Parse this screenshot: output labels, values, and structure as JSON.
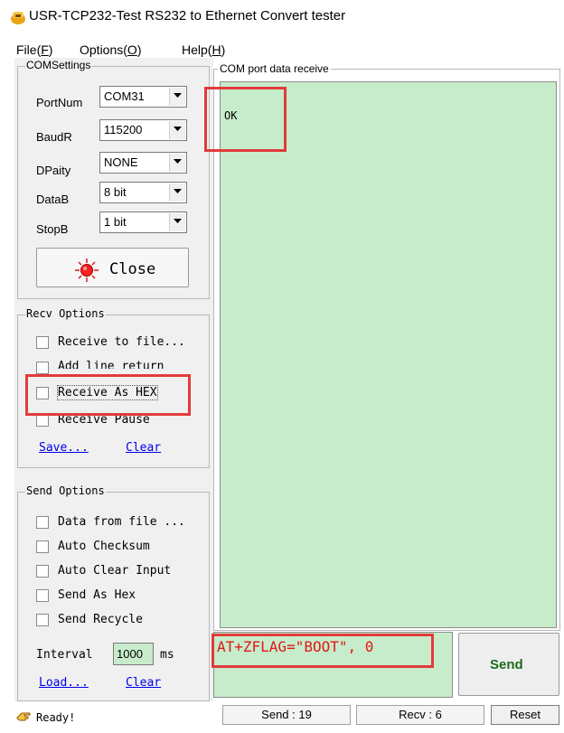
{
  "window": {
    "title": "USR-TCP232-Test  RS232 to Ethernet Convert tester"
  },
  "menu": [
    {
      "label": "File",
      "hotkey": "F"
    },
    {
      "label": "Options",
      "hotkey": "O"
    },
    {
      "label": "Help",
      "hotkey": "H"
    }
  ],
  "com_settings": {
    "title": "COMSettings",
    "port_label": "PortNum",
    "port_value": "COM31",
    "baud_label": "BaudR",
    "baud_value": "115200",
    "parity_label": "DPaity",
    "parity_value": "NONE",
    "databits_label": "DataB",
    "databits_value": "8 bit",
    "stopbits_label": "StopB",
    "stopbits_value": "1 bit",
    "close_button": "Close"
  },
  "recv_options": {
    "title": "Recv Options",
    "items": [
      {
        "label": "Receive to file...",
        "checked": false
      },
      {
        "label": "Add line return",
        "checked": false
      },
      {
        "label": "Receive As HEX",
        "checked": false
      },
      {
        "label": "Receive Pause",
        "checked": false
      }
    ],
    "save_link": "Save...",
    "clear_link": "Clear"
  },
  "send_options": {
    "title": "Send Options",
    "items": [
      {
        "label": "Data from file ...",
        "checked": false
      },
      {
        "label": "Auto Checksum",
        "checked": false
      },
      {
        "label": "Auto Clear Input",
        "checked": false
      },
      {
        "label": "Send As Hex",
        "checked": false
      },
      {
        "label": "Send Recycle",
        "checked": false
      }
    ],
    "interval_label": "Interval",
    "interval_value": "1000",
    "interval_unit": "ms",
    "load_link": "Load...",
    "clear_link": "Clear"
  },
  "receive_panel": {
    "title": "COM port data receive",
    "content": "OK"
  },
  "send_panel": {
    "content": "AT+ZFLAG=\"BOOT\", 0",
    "send_button": "Send"
  },
  "status_bar": {
    "status": "Ready!",
    "send_count": "Send : 19",
    "recv_count": "Recv : 6",
    "reset_button": "Reset"
  },
  "colors": {
    "text_area_bg": "#c7eccb",
    "highlight_box": "#e23b3b",
    "link": "#0000ee",
    "send_button_text": "#1e6b1e"
  }
}
